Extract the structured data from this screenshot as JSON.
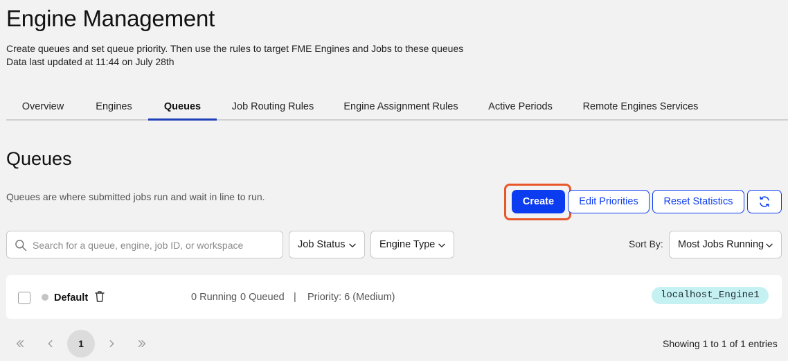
{
  "header": {
    "title": "Engine Management",
    "description_line1": "Create queues and set queue priority. Then use the rules to target FME Engines and Jobs to these queues",
    "description_line2": "Data last updated at 11:44 on July 28th"
  },
  "tabs": [
    {
      "label": "Overview",
      "active": false
    },
    {
      "label": "Engines",
      "active": false
    },
    {
      "label": "Queues",
      "active": true
    },
    {
      "label": "Job Routing Rules",
      "active": false
    },
    {
      "label": "Engine Assignment Rules",
      "active": false
    },
    {
      "label": "Active Periods",
      "active": false
    },
    {
      "label": "Remote Engines Services",
      "active": false
    }
  ],
  "section": {
    "title": "Queues",
    "description": "Queues are where submitted jobs run and wait in line to run."
  },
  "actions": {
    "create_label": "Create",
    "edit_priorities_label": "Edit Priorities",
    "reset_statistics_label": "Reset Statistics",
    "refresh_icon": "refresh-icon"
  },
  "filters": {
    "search_placeholder": "Search for a queue, engine, job ID, or workspace",
    "job_status_label": "Job Status",
    "engine_type_label": "Engine Type",
    "sort_by_label": "Sort By:",
    "sort_by_value": "Most Jobs Running"
  },
  "queues": [
    {
      "name": "Default",
      "running": "0 Running",
      "queued": "0 Queued",
      "separator": "|",
      "priority": "Priority: 6 (Medium)",
      "engine": "localhost_Engine1"
    }
  ],
  "pagination": {
    "current_page": "1",
    "showing": "Showing 1 to 1 of 1 entries"
  },
  "colors": {
    "accent": "#0b3cf0",
    "highlight": "#e8572a",
    "engine_chip": "#c6f1f3",
    "background": "#f2f2f2"
  }
}
